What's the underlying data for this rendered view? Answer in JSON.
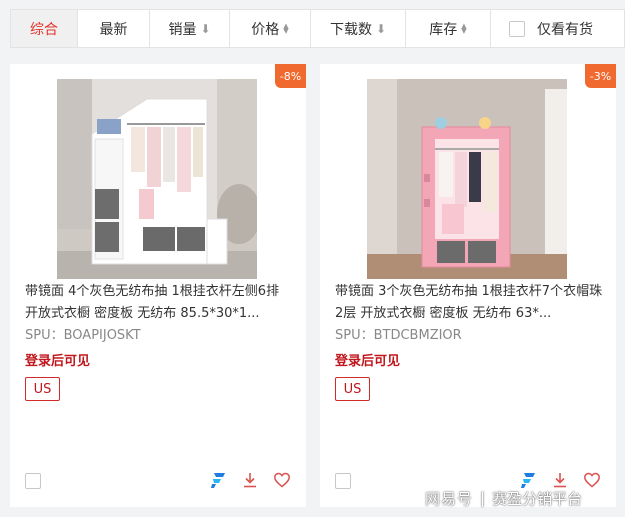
{
  "sort_bar": {
    "items": [
      {
        "label": "综合"
      },
      {
        "label": "最新"
      },
      {
        "label": "销量"
      },
      {
        "label": "价格"
      },
      {
        "label": "下载数"
      },
      {
        "label": "库存"
      }
    ],
    "in_stock_label": "仅看有货",
    "active_color": "#e0322a"
  },
  "products": [
    {
      "discount": "-8%",
      "title": "带镜面 4个灰色无纺布抽 1根挂衣杆左侧6排 开放式衣橱 密度板 无纺布 85.5*30*1...",
      "spu": "SPU：BOAPIJOSKT",
      "price_hint": "登录后可见",
      "region": "US",
      "image": "white children's wardrobe with mirror and gray fabric drawers"
    },
    {
      "discount": "-3%",
      "title": "带镜面 3个灰色无纺布抽 1根挂衣杆7个衣帽珠 2层 开放式衣橱 密度板 无纺布 63*...",
      "spu": "SPU：BTDCBMZIOR",
      "price_hint": "登录后可见",
      "region": "US",
      "image": "pink children's wardrobe with gray fabric drawers"
    }
  ],
  "watermark": {
    "left": "网易号",
    "separator": "|",
    "right": "赛盈分销平台"
  },
  "colors": {
    "discount_badge": "#f06a2f",
    "price_hint": "#c0161c",
    "brand_icon": "#1e7de0"
  }
}
